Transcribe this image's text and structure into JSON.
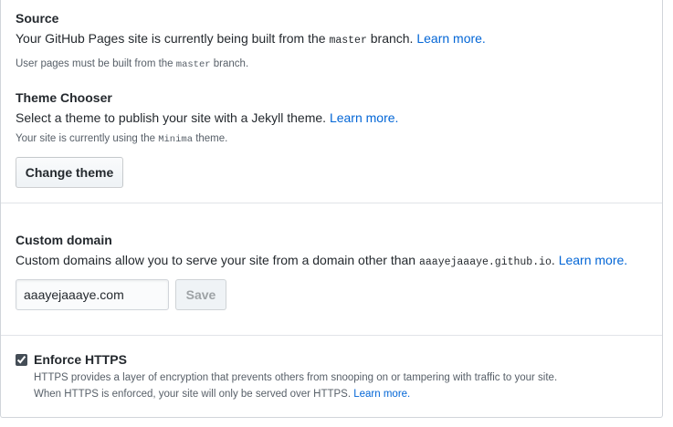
{
  "source": {
    "heading": "Source",
    "line_pre": "Your GitHub Pages site is currently being built from the ",
    "branch": "master",
    "line_post": " branch. ",
    "learn_more": "Learn more.",
    "note_pre": "User pages must be built from the ",
    "note_branch": "master",
    "note_post": " branch."
  },
  "theme": {
    "heading": "Theme Chooser",
    "line": "Select a theme to publish your site with a Jekyll theme. ",
    "learn_more": "Learn more.",
    "note_pre": "Your site is currently using the ",
    "theme_name": "Minima",
    "note_post": " theme.",
    "button_label": "Change theme"
  },
  "custom_domain": {
    "heading": "Custom domain",
    "line_pre": "Custom domains allow you to serve your site from a domain other than ",
    "default_domain": "aaayejaaaye.github.io",
    "line_post": ". ",
    "learn_more": "Learn more.",
    "input_value": "aaayejaaaye.com",
    "save_label": "Save"
  },
  "https": {
    "checkbox_checked": true,
    "label": "Enforce HTTPS",
    "description_1": "HTTPS provides a layer of encryption that prevents others from snooping on or tampering with traffic to your site.",
    "description_2": "When HTTPS is enforced, your site will only be served over HTTPS. ",
    "learn_more": "Learn more."
  },
  "colors": {
    "link": "#0366d6",
    "text": "#24292e",
    "muted": "#586069",
    "border": "#d1d5da"
  }
}
